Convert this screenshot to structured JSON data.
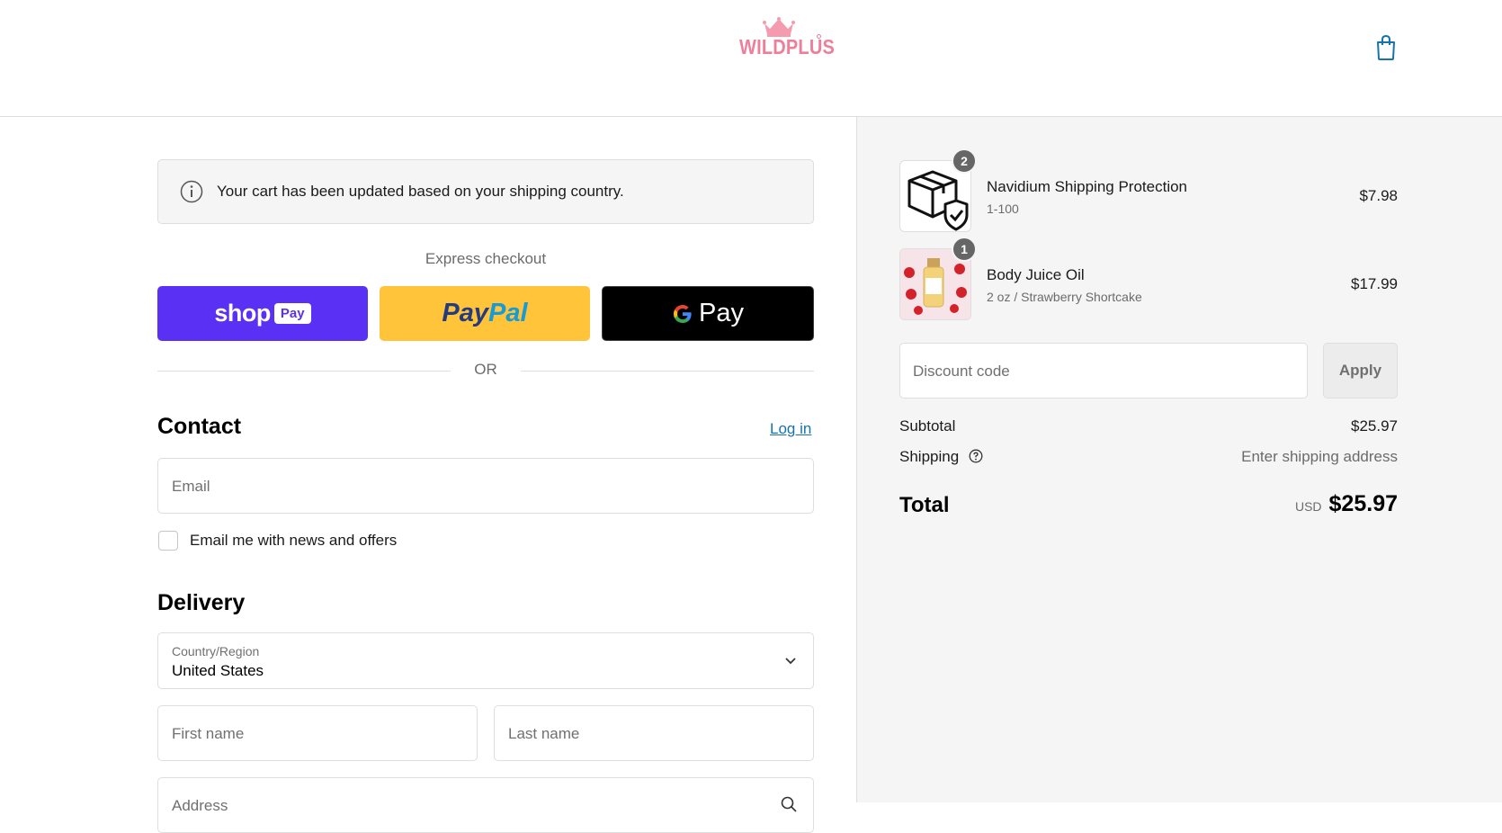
{
  "header": {
    "brand": "WILDPLUS",
    "cart_icon": "shopping-bag-icon"
  },
  "notice": {
    "icon": "info-icon",
    "message": "Your cart has been updated based on your shipping country."
  },
  "express": {
    "label": "Express checkout",
    "shop_pay_word": "shop",
    "shop_pay_pill": "Pay",
    "paypal_part1": "Pay",
    "paypal_part2": "Pal",
    "gpay_word": "Pay",
    "divider_text": "OR"
  },
  "contact": {
    "title": "Contact",
    "login_label": "Log in",
    "email_placeholder": "Email",
    "newsletter_label": "Email me with news and offers"
  },
  "delivery": {
    "title": "Delivery",
    "country_label": "Country/Region",
    "country_value": "United States",
    "first_name_placeholder": "First name",
    "last_name_placeholder": "Last name",
    "address_placeholder": "Address"
  },
  "cart": {
    "items": [
      {
        "name": "Navidium Shipping Protection",
        "variant": "1-100",
        "price": "$7.98",
        "quantity": "2"
      },
      {
        "name": "Body Juice Oil",
        "variant": "2 oz / Strawberry Shortcake",
        "price": "$17.99",
        "quantity": "1"
      }
    ],
    "discount_placeholder": "Discount code",
    "apply_label": "Apply"
  },
  "summary": {
    "subtotal_label": "Subtotal",
    "subtotal_value": "$25.97",
    "shipping_label": "Shipping",
    "shipping_value": "Enter shipping address",
    "total_label": "Total",
    "currency": "USD",
    "total_value": "$25.97"
  },
  "colors": {
    "brand_pink": "#ee7f9a",
    "shop_pay": "#5a31f4",
    "paypal": "#ffc439",
    "link": "#1773b0"
  }
}
